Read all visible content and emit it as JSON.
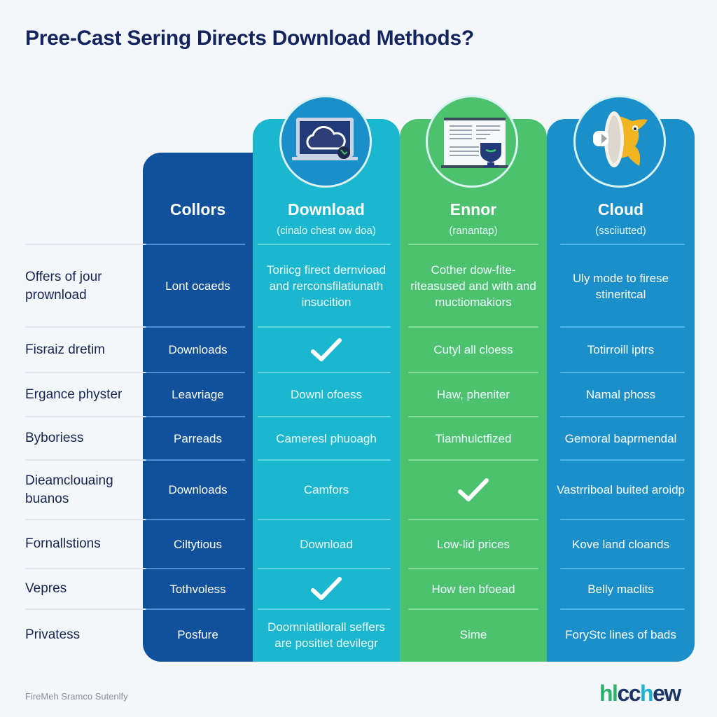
{
  "title": "Pree-Cast Sering Directs Download Methods?",
  "columns": [
    {
      "id": "colors",
      "title": "Collors",
      "subtitle": "",
      "color": "#11509b",
      "icon": ""
    },
    {
      "id": "download",
      "title": "Download",
      "subtitle": "(cinalo chest ow doa)",
      "color": "#1ab7cf",
      "icon": "laptop-cloud-icon"
    },
    {
      "id": "ennor",
      "title": "Ennor",
      "subtitle": "(ranantap)",
      "color": "#4cc26f",
      "icon": "document-shield-icon"
    },
    {
      "id": "cloud",
      "title": "Cloud",
      "subtitle": "(ssciiutted)",
      "color": "#1a8fca",
      "icon": "satellite-dish-mascot-icon"
    }
  ],
  "rows": [
    {
      "label": "Offers of jour prownload",
      "colors": "Lont ocaeds",
      "download": "Toriicg firect dernvioad and rerconsfilatiunath insucition",
      "ennor": "Cother dow-fite-riteasused and with and muctiomakiors",
      "cloud": "Uly mode to firese stineritcal"
    },
    {
      "label": "Fisraiz dretim",
      "colors": "Downloads",
      "download": "✓",
      "ennor": "Cutyl all cloess",
      "cloud": "Totirrоill iptrs"
    },
    {
      "label": "Ergance physter",
      "colors": "Leavriage",
      "download": "Downl ofoess",
      "ennor": "Haw, pheniter",
      "cloud": "Namal phoss"
    },
    {
      "label": "Byboriess",
      "colors": "Parreads",
      "download": "Cameresl phuoagh",
      "ennor": "Tiamhulctfized",
      "cloud": "Gemoral baprmendal"
    },
    {
      "label": "Dieamclouaing buanos",
      "colors": "Downloads",
      "download": "Camfors",
      "ennor": "✓",
      "cloud": "Vastrriboal buited aroidp"
    },
    {
      "label": "Fornallstions",
      "colors": "Ciltytious",
      "download": "Download",
      "ennor": "Low-lid prices",
      "cloud": "Kove land cloands"
    },
    {
      "label": "Vepres",
      "colors": "Tothvoless",
      "download": "✓",
      "ennor": "How ten bfoead",
      "cloud": "Belly maclits"
    },
    {
      "label": "Privatess",
      "colors": "Posfure",
      "download": "Doomnlatilorall seffers are positiet devilegr",
      "ennor": "Sime",
      "cloud": "ForyStc lines of bads"
    }
  ],
  "footer": {
    "caption": "FireMeh Sramco Sutenlfy",
    "logo_parts": [
      "hl",
      "cc",
      "h",
      "ew"
    ]
  }
}
